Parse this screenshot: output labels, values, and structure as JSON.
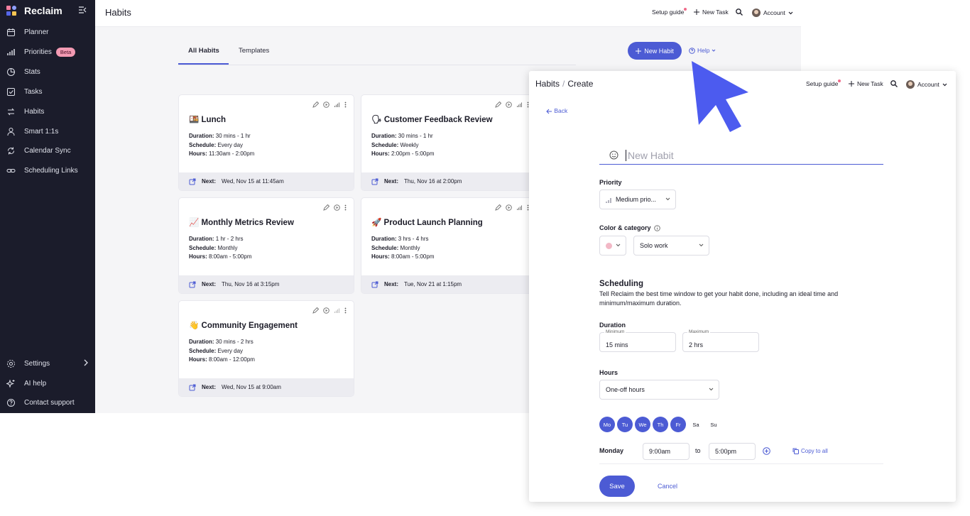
{
  "app": {
    "name": "Reclaim"
  },
  "sidebar": {
    "items": [
      {
        "label": "Planner",
        "icon": "calendar-icon"
      },
      {
        "label": "Priorities",
        "icon": "bars-icon",
        "badge": "Beta"
      },
      {
        "label": "Stats",
        "icon": "stats-icon"
      },
      {
        "label": "Tasks",
        "icon": "tasks-icon"
      },
      {
        "label": "Habits",
        "icon": "habits-icon"
      },
      {
        "label": "Smart 1:1s",
        "icon": "people-icon"
      },
      {
        "label": "Calendar Sync",
        "icon": "sync-icon"
      },
      {
        "label": "Scheduling Links",
        "icon": "link-icon"
      }
    ],
    "bottom": [
      {
        "label": "Settings",
        "icon": "gear-icon"
      },
      {
        "label": "AI help",
        "icon": "sparkle-icon"
      },
      {
        "label": "Contact support",
        "icon": "question-icon"
      }
    ]
  },
  "header": {
    "title": "Habits",
    "setup_guide": "Setup guide",
    "new_task": "New Task",
    "account": "Account"
  },
  "tabs": [
    {
      "label": "All Habits",
      "active": true
    },
    {
      "label": "Templates",
      "active": false
    }
  ],
  "new_habit_button": "New Habit",
  "help": "Help",
  "habits": [
    {
      "emoji": "🍱",
      "title": "Lunch",
      "duration": "30 mins - 1 hr",
      "schedule": "Every day",
      "hours": "11:30am - 2:00pm",
      "next": "Wed, Nov 15 at 11:45am"
    },
    {
      "emoji": "🗣",
      "title": "Customer Feedback Review",
      "duration": "30 mins - 1 hr",
      "schedule": "Weekly",
      "hours": "2:00pm - 5:00pm",
      "next": "Thu, Nov 16 at 2:00pm"
    },
    {
      "emoji": "📈",
      "title": "Monthly Metrics Review",
      "duration": "1 hr - 2 hrs",
      "schedule": "Monthly",
      "hours": "8:00am - 5:00pm",
      "next": "Thu, Nov 16 at 3:15pm"
    },
    {
      "emoji": "🚀",
      "title": "Product Launch Planning",
      "duration": "3 hrs - 4 hrs",
      "schedule": "Monthly",
      "hours": "8:00am - 5:00pm",
      "next": "Tue, Nov 21 at 1:15pm"
    },
    {
      "emoji": "👋",
      "title": "Community Engagement",
      "duration": "30 mins - 2 hrs",
      "schedule": "Every day",
      "hours": "8:00am - 12:00pm",
      "next": "Wed, Nov 15 at 9:00am"
    }
  ],
  "labels": {
    "duration": "Duration:",
    "schedule": "Schedule:",
    "hours": "Hours:",
    "next": "Next:"
  },
  "create_panel": {
    "breadcrumb_root": "Habits",
    "breadcrumb_sep": "/",
    "breadcrumb_current": "Create",
    "setup_guide": "Setup guide",
    "new_task": "New Task",
    "account": "Account",
    "back": "Back",
    "name_placeholder": "New Habit",
    "priority_label": "Priority",
    "priority_value": "Medium prio...",
    "color_label": "Color & category",
    "color_value": "#f2b8c6",
    "category_value": "Solo work",
    "scheduling_title": "Scheduling",
    "scheduling_desc": "Tell Reclaim the best time window to get your habit done, including an ideal time and minimum/maximum duration.",
    "duration_label": "Duration",
    "min_label": "Minimum",
    "min_value": "15 mins",
    "max_label": "Maximum",
    "max_value": "2 hrs",
    "hours_label": "Hours",
    "hours_value": "One-off hours",
    "days": [
      {
        "label": "Mo",
        "on": true
      },
      {
        "label": "Tu",
        "on": true
      },
      {
        "label": "We",
        "on": true
      },
      {
        "label": "Th",
        "on": true
      },
      {
        "label": "Fr",
        "on": true
      },
      {
        "label": "Sa",
        "on": false
      },
      {
        "label": "Su",
        "on": false
      }
    ],
    "day_row_label": "Monday",
    "start_time": "9:00am",
    "to": "to",
    "end_time": "5:00pm",
    "copy_to_all": "Copy to all",
    "save": "Save",
    "cancel": "Cancel"
  },
  "colors": {
    "accent": "#4c5bd4",
    "sidebar": "#1b1c2b",
    "beta": "#f39ab3",
    "cursor": "#4c5bef"
  }
}
